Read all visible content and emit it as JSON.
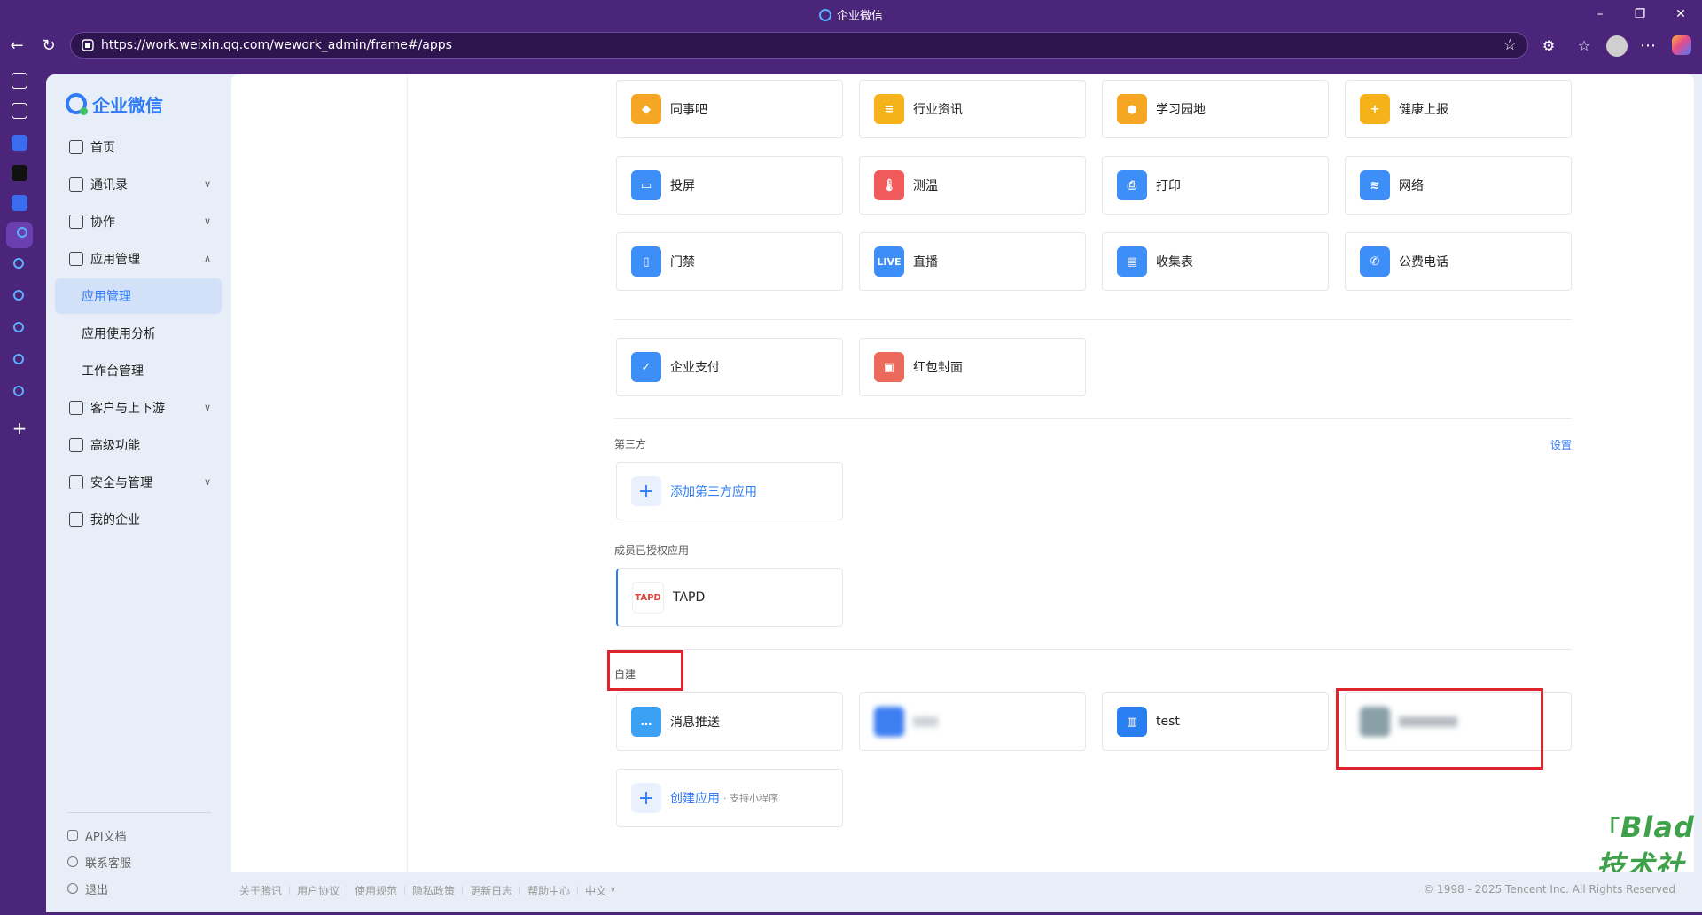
{
  "window": {
    "title": "企业微信"
  },
  "browser": {
    "url": "https://work.weixin.qq.com/wework_admin/frame#/apps"
  },
  "sidebar": {
    "brand": "企业微信",
    "items": [
      {
        "label": "首页",
        "icon": "home-icon"
      },
      {
        "label": "通讯录",
        "icon": "contacts-icon",
        "expandable": true
      },
      {
        "label": "协作",
        "icon": "collab-icon",
        "expandable": true
      },
      {
        "label": "应用管理",
        "icon": "apps-icon",
        "expanded": true
      },
      {
        "label": "应用管理",
        "sub": true,
        "active": true
      },
      {
        "label": "应用使用分析",
        "sub": true
      },
      {
        "label": "工作台管理",
        "sub": true
      },
      {
        "label": "客户与上下游",
        "icon": "customer-icon",
        "expandable": true
      },
      {
        "label": "高级功能",
        "icon": "advanced-icon"
      },
      {
        "label": "安全与管理",
        "icon": "security-icon",
        "expandable": true
      },
      {
        "label": "我的企业",
        "icon": "company-icon"
      }
    ],
    "footer": [
      "API文档",
      "联系客服",
      "退出"
    ]
  },
  "apps": {
    "row1": [
      {
        "label": "同事吧",
        "color": "#f5a623"
      },
      {
        "label": "行业资讯",
        "color": "#f5b21a"
      },
      {
        "label": "学习园地",
        "color": "#f5a623"
      },
      {
        "label": "健康上报",
        "color": "#f5b21a"
      }
    ],
    "row2": [
      {
        "label": "投屏",
        "color": "#3d8ef7"
      },
      {
        "label": "测温",
        "color": "#f05a5a"
      },
      {
        "label": "打印",
        "color": "#3d8ef7"
      },
      {
        "label": "网络",
        "color": "#3d8ef7"
      }
    ],
    "row3": [
      {
        "label": "门禁",
        "color": "#3d8ef7"
      },
      {
        "label": "直播",
        "color": "#3d8ef7",
        "glyph": "LIVE"
      },
      {
        "label": "收集表",
        "color": "#3d8ef7"
      },
      {
        "label": "公费电话",
        "color": "#3d8ef7"
      }
    ],
    "row4": [
      {
        "label": "企业支付",
        "color": "#3d8ef7"
      },
      {
        "label": "红包封面",
        "color": "#ec6a5c"
      }
    ]
  },
  "third_party": {
    "section": "第三方",
    "settings": "设置",
    "add_label": "添加第三方应用"
  },
  "authorized": {
    "section": "成员已授权应用",
    "app": "TAPD"
  },
  "custom": {
    "section": "自建",
    "apps": [
      {
        "label": "消息推送",
        "color": "#3aa1f5"
      },
      {
        "label": "",
        "color": "#3d7ef0",
        "blurred": true
      },
      {
        "label": "test",
        "color": "#2a7ff0"
      },
      {
        "label": "",
        "color": "#6a8a9a",
        "blurred": true
      }
    ],
    "create_label": "创建应用",
    "create_sub": "· 支持小程序"
  },
  "watermark": "Blade技术社区",
  "footer": {
    "links": [
      "关于腾讯",
      "用户协议",
      "使用规范",
      "隐私政策",
      "更新日志",
      "帮助中心",
      "中文"
    ],
    "copyright": "© 1998 - 2025 Tencent Inc. All Rights Reserved"
  }
}
